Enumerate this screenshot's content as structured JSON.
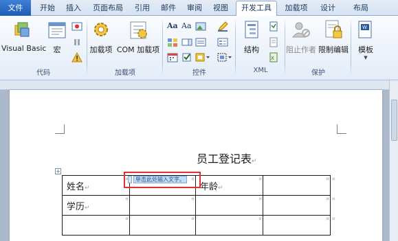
{
  "tabs": [
    {
      "label": "文件"
    },
    {
      "label": "开始"
    },
    {
      "label": "插入"
    },
    {
      "label": "页面布局"
    },
    {
      "label": "引用"
    },
    {
      "label": "邮件"
    },
    {
      "label": "审阅"
    },
    {
      "label": "视图"
    },
    {
      "label": "开发工具"
    },
    {
      "label": "加载项"
    },
    {
      "label": "设计"
    },
    {
      "label": "布局"
    }
  ],
  "ribbon": {
    "groups": {
      "code": "代码",
      "addins": "加载项",
      "controls": "控件",
      "xml": "XML",
      "protect": "保护"
    },
    "buttons": {
      "visual_basic": "Visual Basic",
      "macro": "宏",
      "addins": "加载项",
      "com_addins": "COM 加载项",
      "structure": "结构",
      "block_authors": "阻止作者",
      "restrict_editing": "限制编辑",
      "template": "模板"
    }
  },
  "document": {
    "title": "员工登记表",
    "content_control_placeholder": "单击此处输入文字。",
    "table": {
      "rows": [
        [
          "姓名",
          "",
          "年龄",
          "",
          ""
        ],
        [
          "学历",
          "",
          "",
          "",
          ""
        ],
        [
          "",
          "",
          "",
          "",
          ""
        ]
      ]
    }
  },
  "colors": {
    "file_tab": "#2a6cc9",
    "highlight_box": "#e03030",
    "content_control_fill": "#c6dcf4"
  }
}
